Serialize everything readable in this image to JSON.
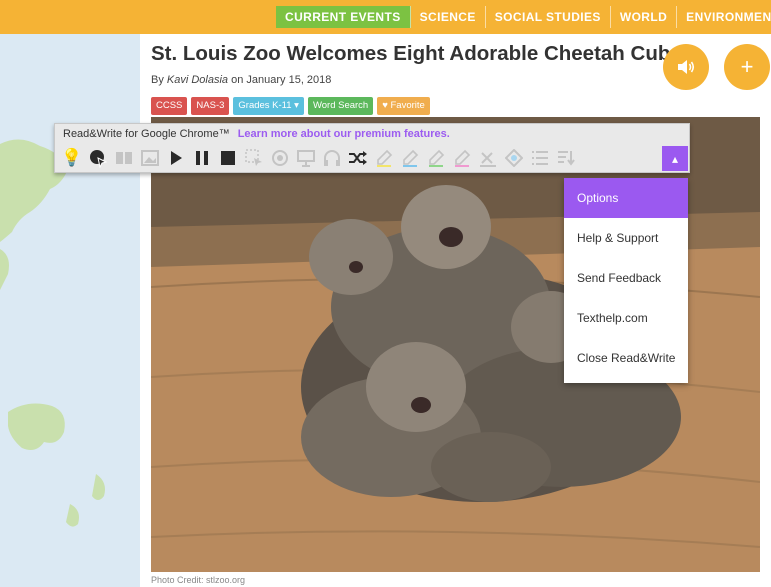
{
  "nav": {
    "items": [
      "CURRENT EVENTS",
      "SCIENCE",
      "SOCIAL STUDIES",
      "WORLD",
      "ENVIRONMENT"
    ],
    "active": "CURRENT EVENTS"
  },
  "article": {
    "title": "St. Louis Zoo Welcomes Eight Adorable Cheetah Cubs",
    "byline_prefix": "By ",
    "author": "Kavi Dolasia",
    "byline_date": " on January 15, 2018",
    "photo_credit": "Photo Credit: stlzoo.org"
  },
  "actions": {
    "audio_icon": "speaker-icon",
    "add_icon": "plus-icon",
    "add_glyph": "+"
  },
  "tags": [
    {
      "label": "CCSS",
      "color": "#d9534f"
    },
    {
      "label": "NAS-3",
      "color": "#d9534f"
    },
    {
      "label": "Grades K-11 ▾",
      "color": "#5bc0de"
    },
    {
      "label": "Word Search",
      "color": "#5cb85c"
    },
    {
      "label": "♥ Favorite",
      "color": "#f0ad4e"
    }
  ],
  "toolbar": {
    "title": "Read&Write for Google Chrome™",
    "premium_link": "Learn more about our premium features.",
    "toggle_glyph": "▴",
    "accent": "#9b59f0"
  },
  "menu": {
    "items": [
      "Options",
      "Help & Support",
      "Send Feedback",
      "Texthelp.com",
      "Close Read&Write"
    ],
    "selected": "Options"
  },
  "colors": {
    "brand": "#f5b335",
    "nav_active": "#7cc242",
    "map_water": "#dbe9f3",
    "map_land": "#c9e0ad"
  }
}
